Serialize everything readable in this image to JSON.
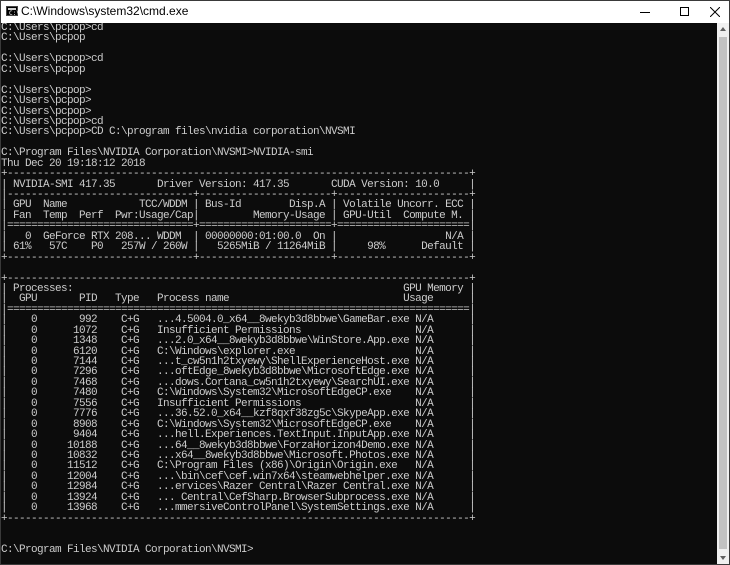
{
  "window": {
    "title": "C:\\Windows\\system32\\cmd.exe",
    "icon_name": "cmd-icon",
    "controls": [
      "minimize-icon",
      "maximize-icon",
      "close-icon"
    ]
  },
  "console": {
    "lines": [
      "C:\\Users\\pcpop>cd",
      "C:\\Users\\pcpop",
      "",
      "C:\\Users\\pcpop>cd",
      "C:\\Users\\pcpop",
      "",
      "C:\\Users\\pcpop>",
      "C:\\Users\\pcpop>",
      "C:\\Users\\pcpop>",
      "C:\\Users\\pcpop>cd",
      "C:\\Users\\pcpop>CD C:\\program files\\nvidia corporation\\NVSMI",
      "",
      "C:\\Program Files\\NVIDIA Corporation\\NVSMI>NVIDIA-smi",
      "Thu Dec 20 19:18:12 2018",
      "+-----------------------------------------------------------------------------+",
      "| NVIDIA-SMI 417.35       Driver Version: 417.35       CUDA Version: 10.0     |",
      "|-------------------------------+----------------------+----------------------+",
      "| GPU  Name            TCC/WDDM | Bus-Id        Disp.A | Volatile Uncorr. ECC |",
      "| Fan  Temp  Perf  Pwr:Usage/Cap|         Memory-Usage | GPU-Util  Compute M. |",
      "|===============================+======================+======================|",
      "|   0  GeForce RTX 208... WDDM  | 00000000:01:00.0  On |                  N/A |",
      "| 61%   57C    P0   257W / 260W |   5265MiB / 11264MiB |     98%      Default |",
      "+-------------------------------+----------------------+----------------------+",
      "",
      "+-----------------------------------------------------------------------------+",
      "| Processes:                                                       GPU Memory |",
      "|  GPU       PID   Type   Process name                             Usage      |",
      "|=============================================================================|",
      "|    0       992    C+G   ...4.5004.0_x64__8wekyb3d8bbwe\\GameBar.exe N/A      |",
      "|    0      1072    C+G   Insufficient Permissions                   N/A      |",
      "|    0      1348    C+G   ...2.0_x64__8wekyb3d8bbwe\\WinStore.App.exe N/A      |",
      "|    0      6120    C+G   C:\\Windows\\explorer.exe                    N/A      |",
      "|    0      7144    C+G   ...t_cw5n1h2txyewy\\ShellExperienceHost.exe N/A      |",
      "|    0      7296    C+G   ...oftEdge_8wekyb3d8bbwe\\MicrosoftEdge.exe N/A      |",
      "|    0      7468    C+G   ...dows.Cortana_cw5n1h2txyewy\\SearchUI.exe N/A      |",
      "|    0      7480    C+G   C:\\Windows\\System32\\MicrosoftEdgeCP.exe    N/A      |",
      "|    0      7556    C+G   Insufficient Permissions                   N/A      |",
      "|    0      7776    C+G   ...36.52.0_x64__kzf8qxf38zg5c\\SkypeApp.exe N/A      |",
      "|    0      8908    C+G   C:\\Windows\\System32\\MicrosoftEdgeCP.exe    N/A      |",
      "|    0      9404    C+G   ...hell.Experiences.TextInput.InputApp.exe N/A      |",
      "|    0     10188    C+G   ...64__8wekyb3d8bbwe\\ForzaHorizon4Demo.exe N/A      |",
      "|    0     10832    C+G   ...x64__8wekyb3d8bbwe\\Microsoft.Photos.exe N/A      |",
      "|    0     11512    C+G   C:\\Program Files (x86)\\Origin\\Origin.exe   N/A      |",
      "|    0     12004    C+G   ...\\bin\\cef\\cef.win7x64\\steamwebhelper.exe N/A      |",
      "|    0     12984    C+G   ...ervices\\Razer Central\\Razer Central.exe N/A      |",
      "|    0     13924    C+G   ... Central\\CefSharp.BrowserSubprocess.exe N/A      |",
      "|    0     13968    C+G   ...mmersiveControlPanel\\SystemSettings.exe N/A      |",
      "+-----------------------------------------------------------------------------+",
      "",
      "",
      "C:\\Program Files\\NVIDIA Corporation\\NVSMI>"
    ]
  },
  "colors": {
    "background": "#0c0c0c",
    "text": "#cccccc",
    "titlebar": "#ffffff"
  }
}
